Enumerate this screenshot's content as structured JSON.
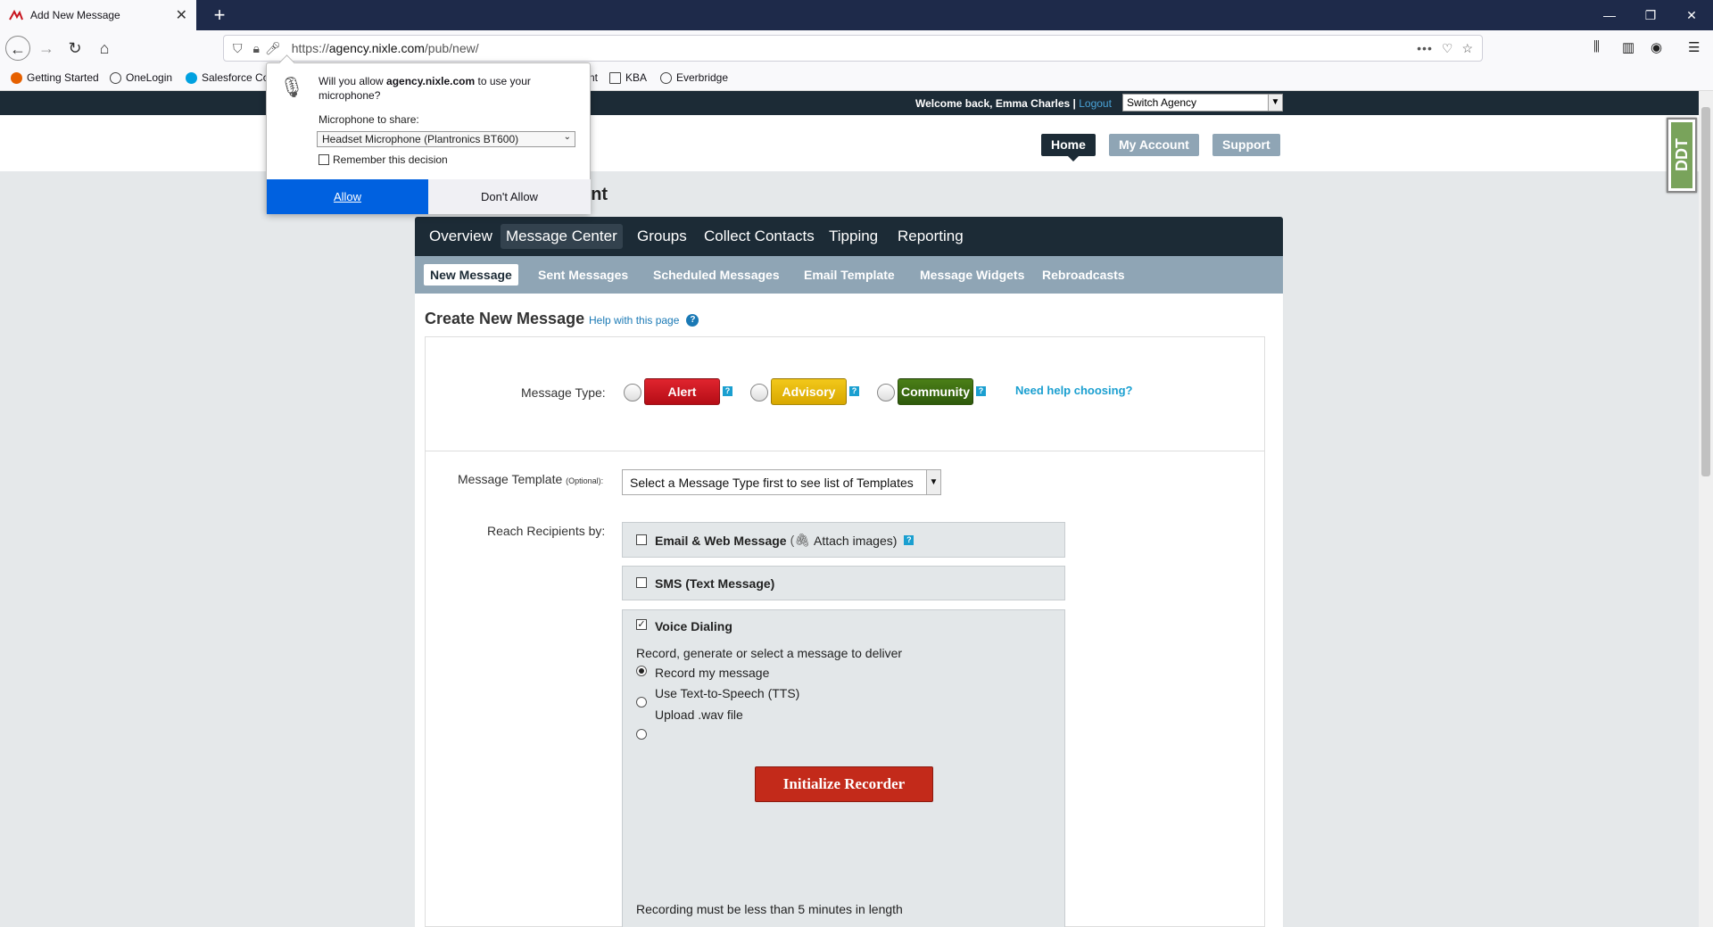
{
  "browser": {
    "tab_title": "Add New Message",
    "url_prefix": "https://",
    "url_host": "agency.nixle.com",
    "url_path": "/pub/new/",
    "bookmarks": [
      "Getting Started",
      "OneLogin",
      "Salesforce Co",
      "nt",
      "KBA",
      "Everbridge"
    ]
  },
  "permission": {
    "question_prefix": "Will you allow ",
    "question_host": "agency.nixle.com",
    "question_suffix": " to use your microphone?",
    "share_label": "Microphone to share:",
    "device": "Headset Microphone (Plantronics BT600)",
    "remember": "Remember this decision",
    "allow": "Allow",
    "deny": "Don't Allow"
  },
  "site": {
    "welcome": "Welcome back, Emma Charles |",
    "logout": "Logout",
    "switch_agency": "Switch Agency",
    "home": "Home",
    "my_account": "My Account",
    "support": "Support",
    "heading_fragment": "unt",
    "ddt": "DDT"
  },
  "main_tabs": [
    "Overview",
    "Message Center",
    "Groups",
    "Collect Contacts",
    "Tipping",
    "Reporting"
  ],
  "sub_tabs": [
    "New Message",
    "Sent Messages",
    "Scheduled Messages",
    "Email Template",
    "Message Widgets",
    "Rebroadcasts"
  ],
  "form": {
    "title": "Create New Message",
    "help": "Help with this page",
    "message_type_label": "Message Type:",
    "types": [
      {
        "label": "Alert",
        "color": "#c8141e"
      },
      {
        "label": "Advisory",
        "color": "#e0b000"
      },
      {
        "label": "Community",
        "color": "#3d6b12"
      }
    ],
    "need_help": "Need help choosing?",
    "template_label": "Message Template",
    "template_optional": "(Optional):",
    "template_value": "Select a Message Type first to see list of Templates",
    "reach_label": "Reach Recipients by:",
    "email_label": "Email & Web Message",
    "attach_label": "Attach images)",
    "sms_label": "SMS (Text Message)",
    "voice_label": "Voice Dialing",
    "voice_instructions": "Record, generate or select a message to deliver",
    "voice_options": [
      "Record my message",
      "Use Text-to-Speech (TTS)",
      "Upload .wav file"
    ],
    "init_button": "Initialize Recorder",
    "recording_note": "Recording must be less than 5 minutes in length"
  }
}
